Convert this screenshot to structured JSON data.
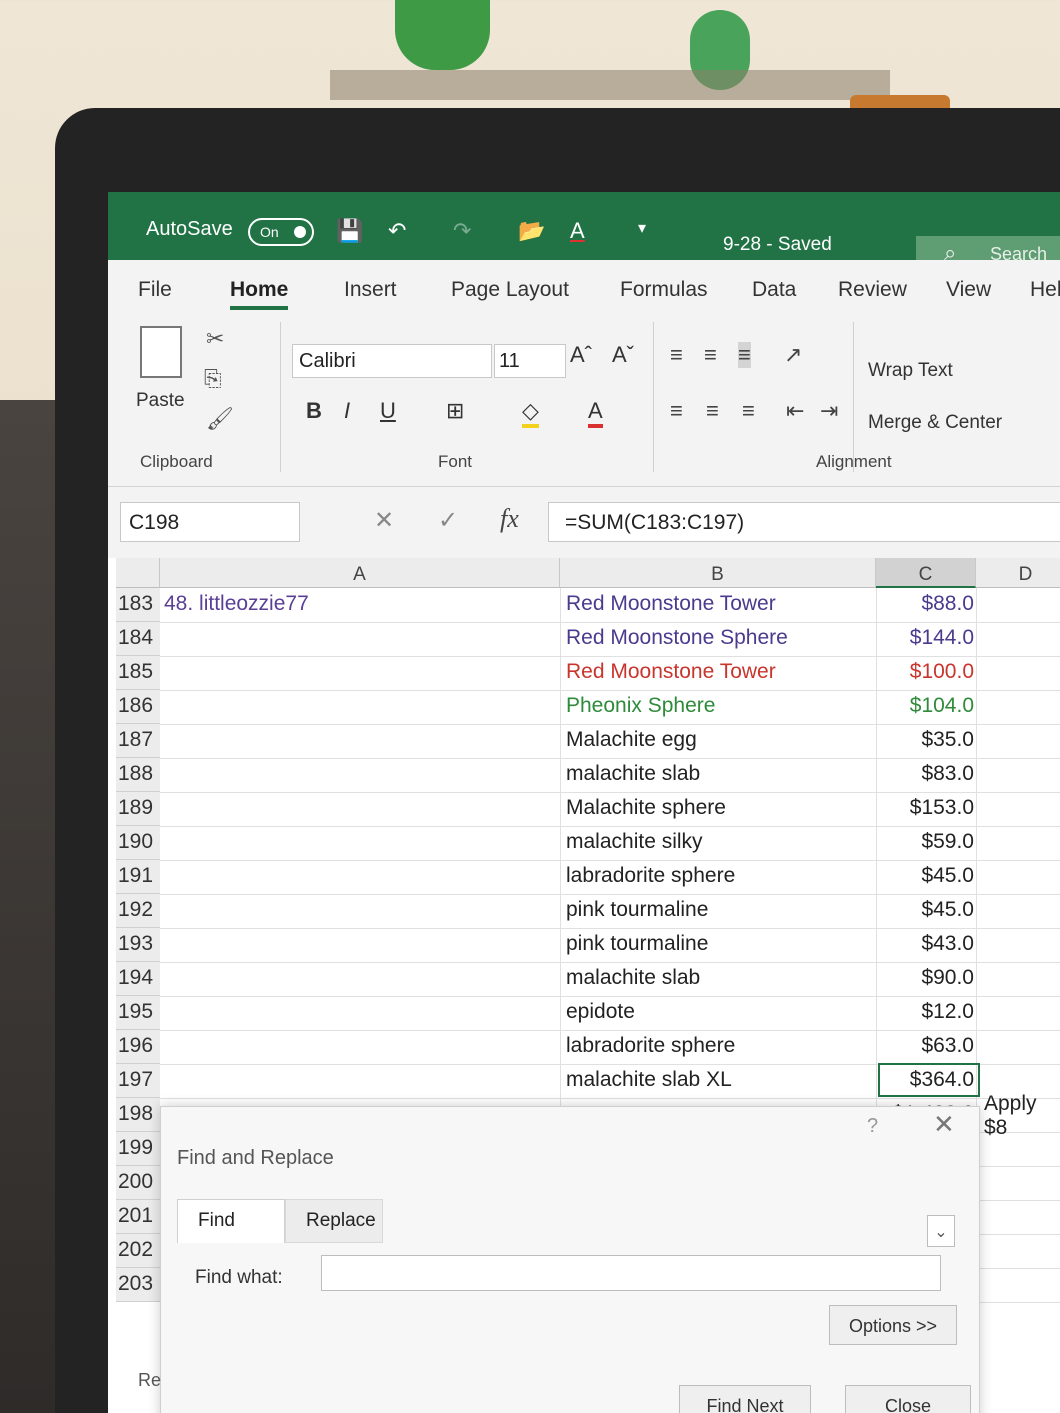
{
  "titlebar": {
    "autosave_label": "AutoSave",
    "toggle_label": "On",
    "doc_title": "9-28 - Saved",
    "search_placeholder": "Search"
  },
  "tabs": [
    "File",
    "Home",
    "Insert",
    "Page Layout",
    "Formulas",
    "Data",
    "Review",
    "View",
    "Hel"
  ],
  "ribbon": {
    "paste_label": "Paste",
    "font_name": "Calibri",
    "font_size": "11",
    "bold": "B",
    "italic": "I",
    "underline": "U",
    "wrap_text": "Wrap Text",
    "merge_center": "Merge & Center",
    "groups": {
      "clipboard": "Clipboard",
      "font": "Font",
      "alignment": "Alignment"
    }
  },
  "formula_bar": {
    "name_box": "C198",
    "formula": "=SUM(C183:C197)"
  },
  "columns": [
    "A",
    "B",
    "C",
    "D"
  ],
  "rows": [
    {
      "num": "183",
      "a": "48. littleozzie77",
      "b": "Red Moonstone Tower",
      "c": "$88.0",
      "color": "#4b3a8e"
    },
    {
      "num": "184",
      "a": "",
      "b": "Red Moonstone Sphere",
      "c": "$144.0",
      "color": "#4b3a8e"
    },
    {
      "num": "185",
      "a": "",
      "b": "Red Moonstone Tower",
      "c": "$100.0",
      "color": "#c8352d"
    },
    {
      "num": "186",
      "a": "",
      "b": "Pheonix Sphere",
      "c": "$104.0",
      "color": "#2e8b3a"
    },
    {
      "num": "187",
      "a": "",
      "b": "Malachite egg",
      "c": "$35.0",
      "color": "#222222"
    },
    {
      "num": "188",
      "a": "",
      "b": "malachite slab",
      "c": "$83.0",
      "color": "#222222"
    },
    {
      "num": "189",
      "a": "",
      "b": "Malachite sphere",
      "c": "$153.0",
      "color": "#222222"
    },
    {
      "num": "190",
      "a": "",
      "b": "malachite silky",
      "c": "$59.0",
      "color": "#222222"
    },
    {
      "num": "191",
      "a": "",
      "b": "labradorite sphere",
      "c": "$45.0",
      "color": "#222222"
    },
    {
      "num": "192",
      "a": "",
      "b": "pink tourmaline",
      "c": "$45.0",
      "color": "#222222"
    },
    {
      "num": "193",
      "a": "",
      "b": "pink tourmaline",
      "c": "$43.0",
      "color": "#222222"
    },
    {
      "num": "194",
      "a": "",
      "b": "malachite slab",
      "c": "$90.0",
      "color": "#222222"
    },
    {
      "num": "195",
      "a": "",
      "b": "epidote",
      "c": "$12.0",
      "color": "#222222"
    },
    {
      "num": "196",
      "a": "",
      "b": "labradorite sphere",
      "c": "$63.0",
      "color": "#222222"
    },
    {
      "num": "197",
      "a": "",
      "b": "malachite slab XL",
      "c": "$364.0",
      "color": "#222222"
    },
    {
      "num": "198",
      "a": "",
      "b": "",
      "c": "$1,428.0",
      "color": "#222222"
    },
    {
      "num": "199",
      "a": "",
      "b": "",
      "c": "",
      "color": "#222222"
    },
    {
      "num": "200",
      "a": "",
      "b": "",
      "c": "",
      "color": "#222222"
    },
    {
      "num": "201",
      "a": "",
      "b": "",
      "c": "",
      "color": "#222222"
    },
    {
      "num": "202",
      "a": "",
      "b": "",
      "c": "",
      "color": "#222222"
    },
    {
      "num": "203",
      "a": "",
      "b": "",
      "c": "",
      "color": "#222222"
    }
  ],
  "side_text": "Apply $8",
  "dialog": {
    "title": "Find and Replace",
    "help": "?",
    "tab_find": "Find",
    "tab_replace": "Replace",
    "find_what_label": "Find what:",
    "find_what_value": "",
    "options_button": "Options >>",
    "find_next_button": "Find Next",
    "close_button": "Close"
  },
  "status_text": "Re"
}
